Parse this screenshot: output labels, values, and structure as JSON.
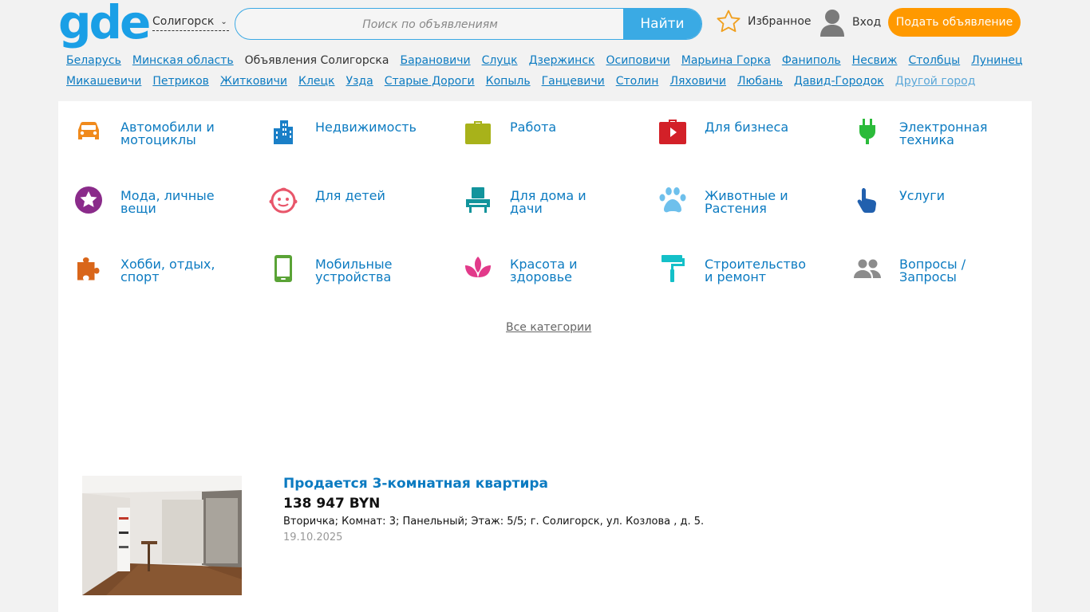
{
  "header": {
    "logo": "gde",
    "city": "Солигорск",
    "search_placeholder": "Поиск по объявлениям",
    "search_button": "Найти",
    "favorites": "Избранное",
    "login": "Вход",
    "post_ad": "Подать объявление"
  },
  "cities": {
    "row1": [
      "Беларусь",
      "Минская область",
      "Объявления Солигорска",
      "Барановичи",
      "Слуцк",
      "Дзержинск",
      "Осиповичи",
      "Марьина Горка",
      "Фаниполь",
      "Несвиж",
      "Столбцы",
      "Лунинец"
    ],
    "row2": [
      "Микашевичи",
      "Петриков",
      "Житковичи",
      "Клецк",
      "Узда",
      "Старые Дороги",
      "Копыль",
      "Ганцевичи",
      "Столин",
      "Ляховичи",
      "Любань",
      "Давид-Городок",
      "Другой город"
    ]
  },
  "categories": [
    {
      "label_1": "Автомобили и",
      "label_2": "мотоциклы",
      "icon": "car-icon",
      "color": "#f08a1c"
    },
    {
      "label_1": "Недвижимость",
      "label_2": "",
      "icon": "buildings-icon",
      "color": "#1a7fc7"
    },
    {
      "label_1": "Работа",
      "label_2": "",
      "icon": "briefcase-icon",
      "color": "#a8b21a"
    },
    {
      "label_1": "Для бизнеса",
      "label_2": "",
      "icon": "business-case-icon",
      "color": "#d32028"
    },
    {
      "label_1": "Электронная",
      "label_2": "техника",
      "icon": "plug-icon",
      "color": "#2bbb3a"
    },
    {
      "label_1": "Мода, личные",
      "label_2": "вещи",
      "icon": "star-icon",
      "color": "#8a2b8a"
    },
    {
      "label_1": "Для детей",
      "label_2": "",
      "icon": "baby-face-icon",
      "color": "#e8566a"
    },
    {
      "label_1": "Для дома и",
      "label_2": "дачи",
      "icon": "armchair-icon",
      "color": "#12949c"
    },
    {
      "label_1": "Животные и",
      "label_2": "Растения",
      "icon": "paw-icon",
      "color": "#6ec0ec"
    },
    {
      "label_1": "Услуги",
      "label_2": "",
      "icon": "pointing-hand-icon",
      "color": "#2160ae"
    },
    {
      "label_1": "Хобби, отдых,",
      "label_2": "спорт",
      "icon": "puzzle-icon",
      "color": "#d9661a"
    },
    {
      "label_1": "Мобильные",
      "label_2": "устройства",
      "icon": "smartphone-icon",
      "color": "#5aa336"
    },
    {
      "label_1": "Красота и",
      "label_2": "здоровье",
      "icon": "lotus-icon",
      "color": "#e23a8a"
    },
    {
      "label_1": "Строительство",
      "label_2": "и ремонт",
      "icon": "paint-roller-icon",
      "color": "#14c0c8"
    },
    {
      "label_1": "Вопросы /",
      "label_2": "Запросы",
      "icon": "people-icon",
      "color": "#8c8c8c"
    }
  ],
  "all_categories": "Все категории",
  "listing": {
    "title": "Продается 3-комнатная квартира",
    "price": "138 947 BYN",
    "description": "Вторичка; Комнат: 3; Панельный; Этаж: 5/5; г. Солигорск, ул. Козлова , д. 5.",
    "date": "19.10.2025"
  }
}
